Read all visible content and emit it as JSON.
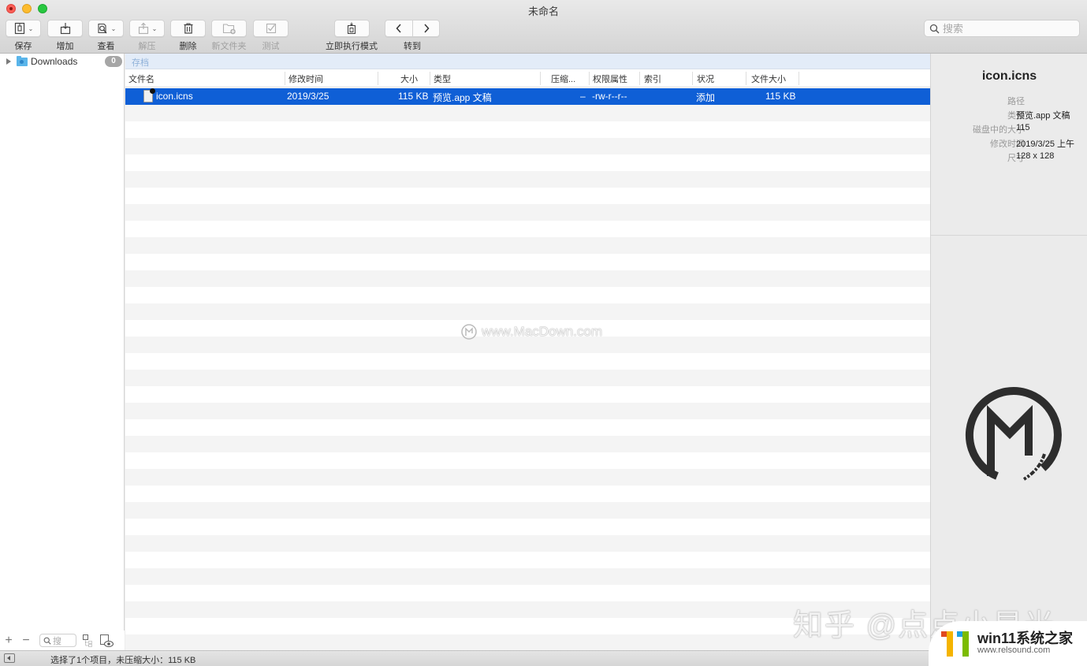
{
  "window": {
    "title": "未命名"
  },
  "toolbar": {
    "items": [
      {
        "id": "save",
        "label": "保存",
        "enabled": true,
        "has_menu": true,
        "icon": "archive-icon"
      },
      {
        "id": "add",
        "label": "增加",
        "enabled": true,
        "has_menu": false,
        "icon": "add-to-archive-icon"
      },
      {
        "id": "view",
        "label": "查看",
        "enabled": true,
        "has_menu": true,
        "icon": "quick-look-icon"
      },
      {
        "id": "extract",
        "label": "解压",
        "enabled": false,
        "has_menu": true,
        "icon": "extract-icon"
      },
      {
        "id": "delete",
        "label": "删除",
        "enabled": true,
        "has_menu": false,
        "icon": "trash-icon"
      },
      {
        "id": "new-folder",
        "label": "新文件夹",
        "enabled": false,
        "has_menu": false,
        "icon": "new-folder-icon"
      },
      {
        "id": "test",
        "label": "测试",
        "enabled": false,
        "has_menu": false,
        "icon": "checkmark-icon"
      },
      {
        "id": "instant-mode",
        "label": "立即执行模式",
        "enabled": true,
        "has_menu": false,
        "icon": "instant-mode-icon"
      }
    ],
    "goto_label": "转到",
    "back_icon": "chevron-left-icon",
    "forward_icon": "chevron-right-icon"
  },
  "search": {
    "placeholder": "搜索",
    "value": ""
  },
  "sidebar": {
    "items": [
      {
        "label": "Downloads",
        "badge": "0",
        "icon": "folder-icon"
      }
    ],
    "footer": {
      "add": "+",
      "remove": "−",
      "search_placeholder": "搜"
    }
  },
  "archive": {
    "path_label": "存档",
    "columns": [
      "文件名",
      "修改时间",
      "大小",
      "类型",
      "压缩...",
      "权限属性",
      "索引",
      "状况",
      "文件大小"
    ],
    "rows": [
      {
        "name": "icon.icns",
        "modified": "2019/3/25",
        "size": "115 KB",
        "type": "预览.app 文稿",
        "compressed": "–",
        "permissions": "-rw-r--r--",
        "index": "",
        "status": "添加",
        "file_size": "115 KB",
        "selected": true
      }
    ]
  },
  "inspector": {
    "title": "icon.icns",
    "fields": [
      {
        "key": "路径",
        "value": ""
      },
      {
        "key": "类型",
        "value": "预览.app 文稿"
      },
      {
        "key": "磁盘中的大小",
        "value": "115"
      },
      {
        "key": "修改时间",
        "value": "2019/3/25 上午"
      },
      {
        "key": "尺寸",
        "value": "128 x 128"
      }
    ]
  },
  "status": {
    "text": "选择了1个项目，未压缩大小：115 KB"
  },
  "watermarks": {
    "macdown": "www.MacDown.com",
    "zhihu": "知乎 @点点小星光",
    "win11_title": "win11系统之家",
    "win11_url": "www.relsound.com"
  },
  "colors": {
    "selection": "#0f5fd6",
    "path_bar": "#e3ecf8"
  }
}
